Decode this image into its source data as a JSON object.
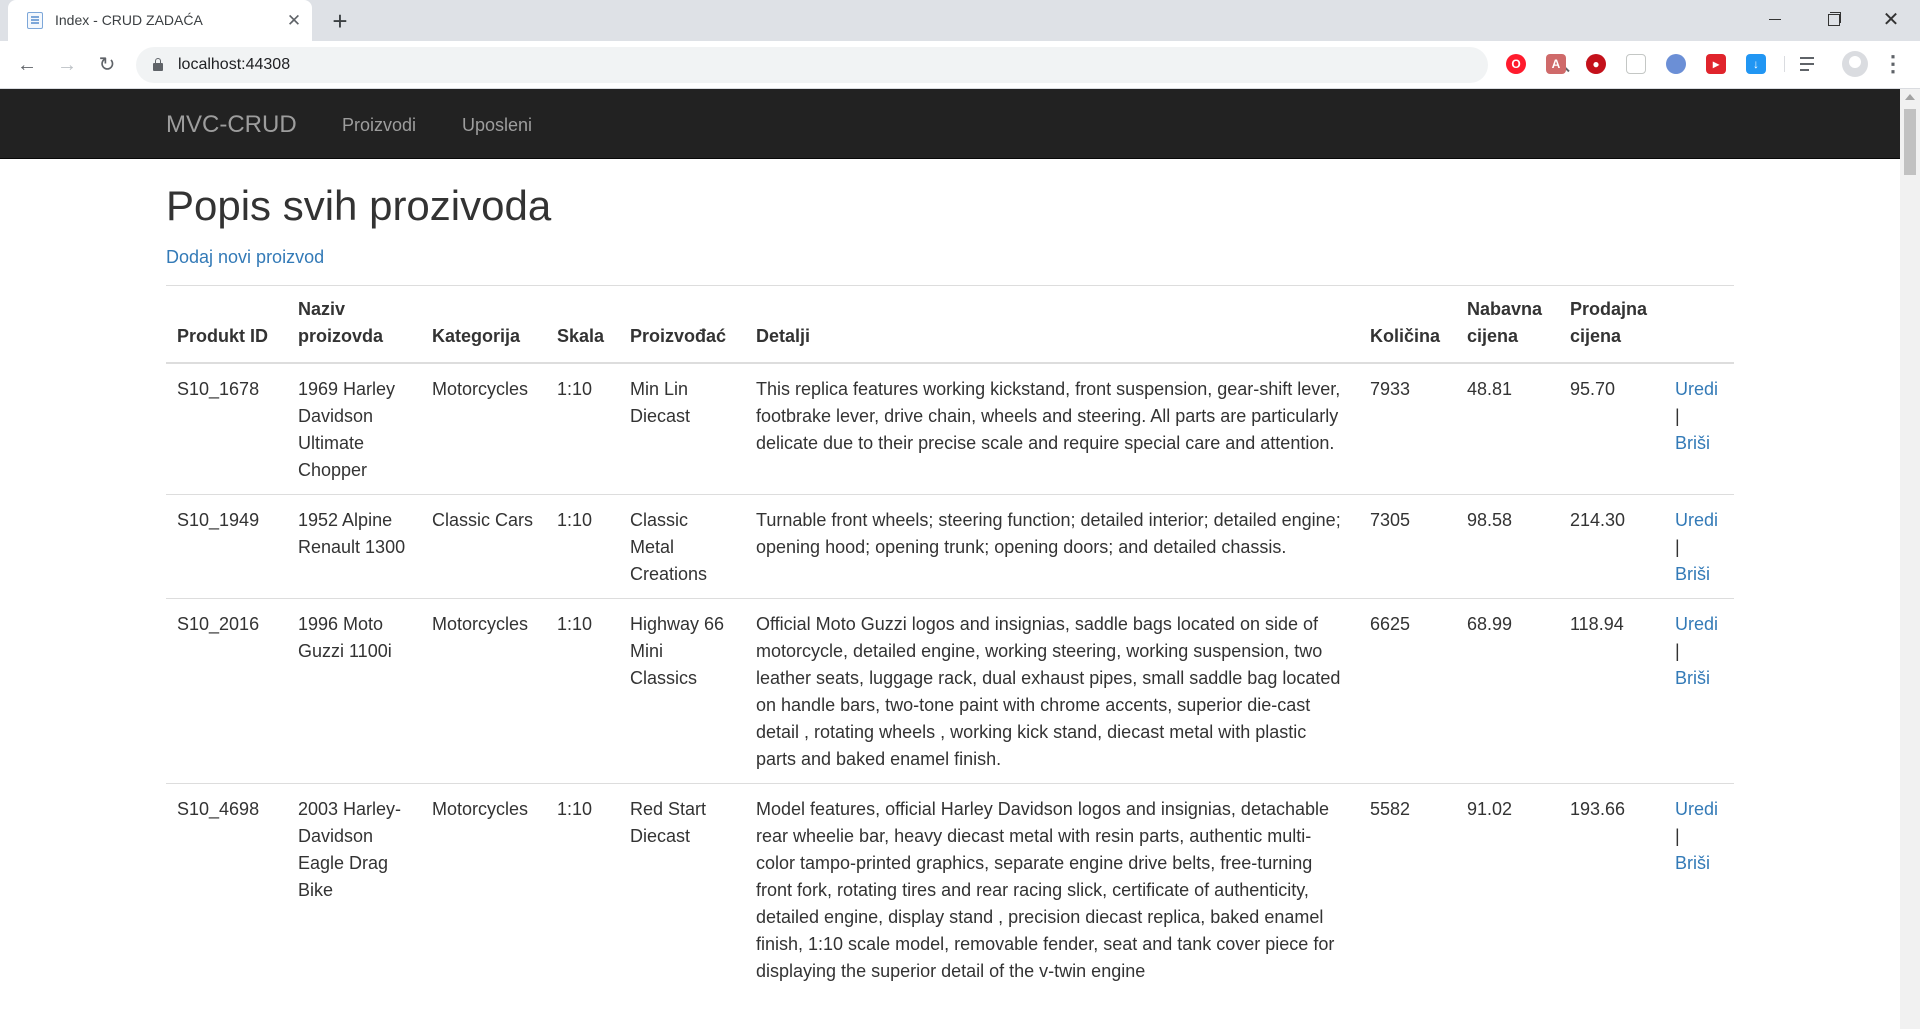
{
  "browser": {
    "tab_title": "Index - CRUD ZADAĆA",
    "tab_close": "✕",
    "new_tab": "+",
    "url": "localhost:44308"
  },
  "navbar": {
    "brand": "MVC-CRUD",
    "links": [
      "Proizvodi",
      "Uposleni"
    ]
  },
  "page": {
    "title": "Popis svih prozivoda",
    "add_link": "Dodaj novi proizvod"
  },
  "table": {
    "headers": [
      "Produkt ID",
      "Naziv proizovda",
      "Kategorija",
      "Skala",
      "Proizvođać",
      "Detalji",
      "Količina",
      "Nabavna cijena",
      "Prodajna cijena",
      ""
    ],
    "action_edit": "Uredi",
    "action_sep": "|",
    "action_delete": "Briši",
    "rows": [
      {
        "id": "S10_1678",
        "name": "1969 Harley Davidson Ultimate Chopper",
        "category": "Motorcycles",
        "scale": "1:10",
        "vendor": "Min Lin Diecast",
        "details": "This replica features working kickstand, front suspension, gear-shift lever, footbrake lever, drive chain, wheels and steering. All parts are particularly delicate due to their precise scale and require special care and attention.",
        "qty": "7933",
        "buy": "48.81",
        "sell": "95.70"
      },
      {
        "id": "S10_1949",
        "name": "1952 Alpine Renault 1300",
        "category": "Classic Cars",
        "scale": "1:10",
        "vendor": "Classic Metal Creations",
        "details": "Turnable front wheels; steering function; detailed interior; detailed engine; opening hood; opening trunk; opening doors; and detailed chassis.",
        "qty": "7305",
        "buy": "98.58",
        "sell": "214.30"
      },
      {
        "id": "S10_2016",
        "name": "1996 Moto Guzzi 1100i",
        "category": "Motorcycles",
        "scale": "1:10",
        "vendor": "Highway 66 Mini Classics",
        "details": "Official Moto Guzzi logos and insignias, saddle bags located on side of motorcycle, detailed engine, working steering, working suspension, two leather seats, luggage rack, dual exhaust pipes, small saddle bag located on handle bars, two-tone paint with chrome accents, superior die-cast detail , rotating wheels , working kick stand, diecast metal with plastic parts and baked enamel finish.",
        "qty": "6625",
        "buy": "68.99",
        "sell": "118.94"
      },
      {
        "id": "S10_4698",
        "name": "2003 Harley-Davidson Eagle Drag Bike",
        "category": "Motorcycles",
        "scale": "1:10",
        "vendor": "Red Start Diecast",
        "details": "Model features, official Harley Davidson logos and insignias, detachable rear wheelie bar, heavy diecast metal with resin parts, authentic multi-color tampo-printed graphics, separate engine drive belts, free-turning front fork, rotating tires and rear racing slick, certificate of authenticity, detailed engine, display stand , precision diecast replica, baked enamel finish, 1:10 scale model, removable fender, seat and tank cover piece for displaying the superior detail of the v-twin engine",
        "qty": "5582",
        "buy": "91.02",
        "sell": "193.66"
      }
    ]
  },
  "colors": {
    "navbar_bg": "#222222",
    "link": "#337ab7",
    "text": "#333333"
  }
}
